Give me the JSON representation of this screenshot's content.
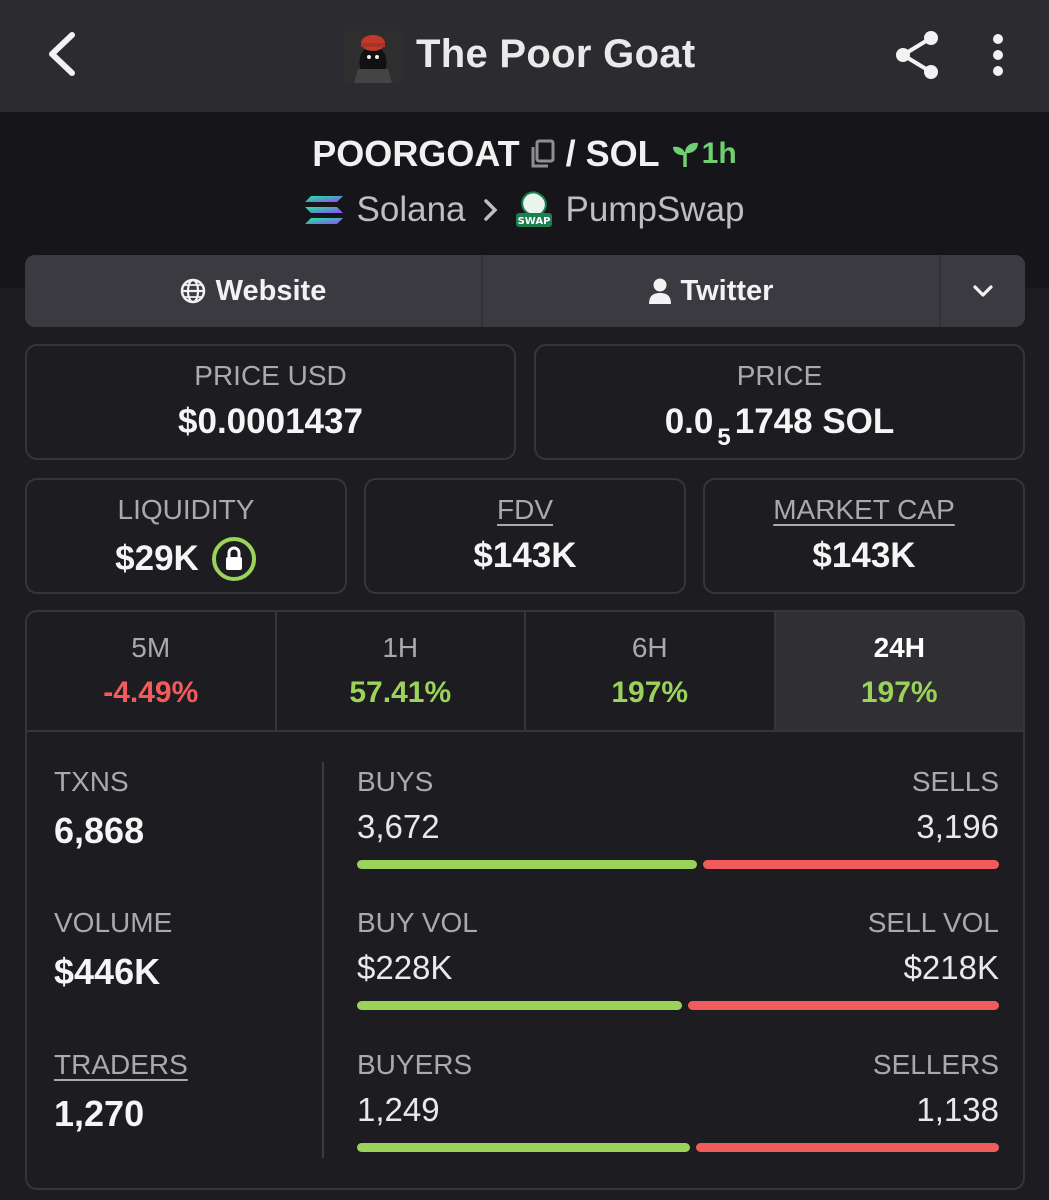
{
  "topbar": {
    "title": "The Poor Goat"
  },
  "pair": {
    "base": "POORGOAT",
    "separator": "/",
    "quote": "SOL",
    "age": "1h"
  },
  "chain": {
    "network": "Solana",
    "dex": "PumpSwap",
    "dex_badge": "SWAP"
  },
  "links": {
    "website": "Website",
    "twitter": "Twitter"
  },
  "price": {
    "usd_label": "PRICE USD",
    "usd_value": "$0.0001437",
    "native_label": "PRICE",
    "native_prefix": "0.0",
    "native_zeros": "5",
    "native_rest": "1748 SOL"
  },
  "metrics": {
    "liquidity_label": "LIQUIDITY",
    "liquidity_value": "$29K",
    "fdv_label": "FDV",
    "fdv_value": "$143K",
    "mcap_label": "MARKET CAP",
    "mcap_value": "$143K"
  },
  "tabs": [
    {
      "label": "5M",
      "value": "-4.49%"
    },
    {
      "label": "1H",
      "value": "57.41%"
    },
    {
      "label": "6H",
      "value": "197%"
    },
    {
      "label": "24H",
      "value": "197%"
    }
  ],
  "stats": {
    "txns_label": "TXNS",
    "txns_value": "6,868",
    "volume_label": "VOLUME",
    "volume_value": "$446K",
    "traders_label": "TRADERS",
    "traders_value": "1,270",
    "buys_label": "BUYS",
    "buys_value": "3,672",
    "sells_label": "SELLS",
    "sells_value": "3,196",
    "buyvol_label": "BUY VOL",
    "buyvol_value": "$228K",
    "sellvol_label": "SELL VOL",
    "sellvol_value": "$218K",
    "buyers_label": "BUYERS",
    "buyers_value": "1,249",
    "sellers_label": "SELLERS",
    "sellers_value": "1,138"
  },
  "colors": {
    "positive": "#9bd25a",
    "negative": "#f25b5b",
    "age": "#6fcf72"
  },
  "bars": {
    "txns_buy_fraction": 0.535,
    "volume_buy_fraction": 0.511,
    "traders_buy_fraction": 0.523
  }
}
